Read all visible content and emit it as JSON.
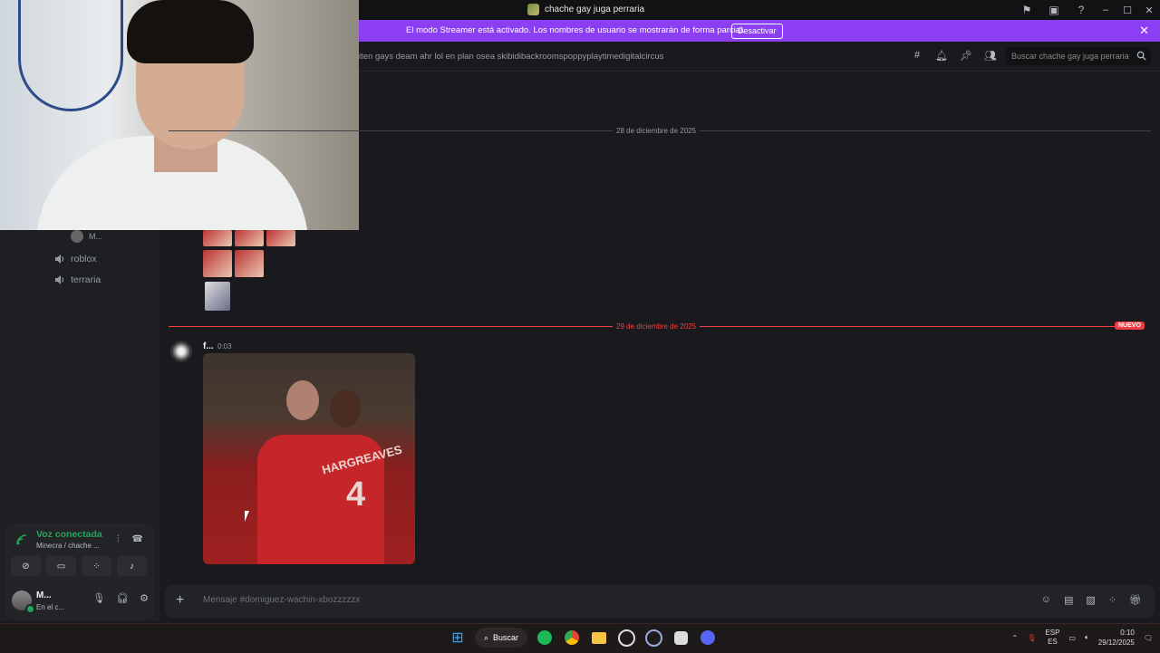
{
  "window": {
    "title": "chache gay juga perraria"
  },
  "banner": {
    "text": "El modo Streamer está activado. Los nombres de usuario se mostrarán de forma parcial.",
    "button": "Desactivar",
    "bg_color": "#8c3ff2"
  },
  "header": {
    "topic": "iten gays deam ahr lol en plan osea skibidibackroomspoppyplaytimedigitalcircus",
    "search_placeholder": "Buscar chache gay juga perraria"
  },
  "sidebar": {
    "voice_user": "M...",
    "voice_channels": [
      {
        "name": "roblox"
      },
      {
        "name": "terraria"
      }
    ]
  },
  "voice_panel": {
    "status": "Voz conectada",
    "channel": "Minecra / chache ...",
    "status_color": "#23a55a"
  },
  "user_bar": {
    "name": "M...",
    "status": "En el c..."
  },
  "chat": {
    "date1": "28 de diciembre de 2025",
    "date2": "29 de diciembre de 2025",
    "new_badge": "NUEVO",
    "message": {
      "author": "f...",
      "time": "0:03"
    },
    "gif_text": {
      "name": "HARGREAVES",
      "number": "4"
    }
  },
  "composer": {
    "placeholder": "Mensaje #domiguez-wachin-xbozzzzzx"
  },
  "taskbar": {
    "search_label": "Buscar",
    "lang_top": "ESP",
    "lang_bottom": "ES",
    "time": "0:10",
    "date": "29/12/2025"
  }
}
